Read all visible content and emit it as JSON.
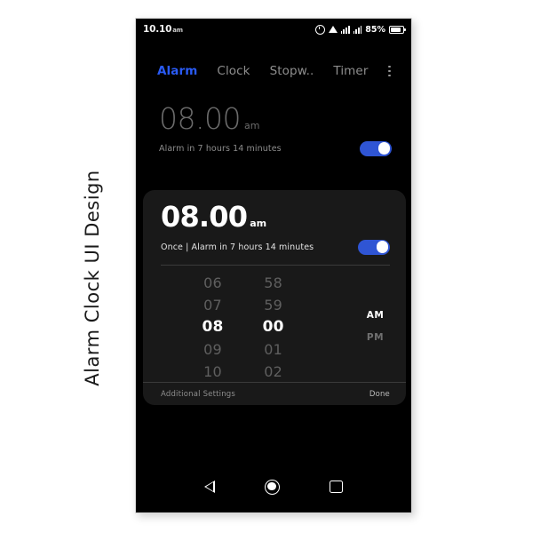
{
  "caption": {
    "text": "Alarm Clock UI Design"
  },
  "status_bar": {
    "time": "10.10",
    "time_suffix": "am",
    "battery_percent": "85%",
    "icons": [
      "clock-icon",
      "wifi-icon",
      "signal-icon",
      "signal-icon",
      "battery-icon"
    ]
  },
  "tabs": [
    {
      "label": "Alarm",
      "active": true
    },
    {
      "label": "Clock",
      "active": false
    },
    {
      "label": "Stopw..",
      "active": false
    },
    {
      "label": "Timer",
      "active": false
    }
  ],
  "overflow_menu": {
    "name": "more-options-icon"
  },
  "alarm_list": [
    {
      "time": "08.00",
      "meridiem": "am",
      "subtitle": "Alarm in 7 hours 14 minutes",
      "enabled": true
    }
  ],
  "alarm_card": {
    "time": "08.00",
    "meridiem": "am",
    "subtitle": "Once | Alarm in 7 hours 14 minutes",
    "enabled": true,
    "picker": {
      "hours": [
        "06",
        "07",
        "08",
        "09",
        "10"
      ],
      "hours_selected_index": 2,
      "minutes": [
        "58",
        "59",
        "00",
        "01",
        "02"
      ],
      "minutes_selected_index": 2,
      "meridiem": [
        "AM",
        "PM"
      ],
      "meridiem_selected_index": 0
    },
    "footer": {
      "additional_settings": "Additional Settings",
      "done": "Done"
    }
  },
  "nav_bar": {
    "back": "back-triangle-icon",
    "home": "home-circle-icon",
    "recents": "recents-square-icon"
  },
  "colors": {
    "accent_blue": "#2a5bf5",
    "toggle_blue": "#2f55d4",
    "screen_black": "#000000",
    "card_gray": "#191919"
  }
}
